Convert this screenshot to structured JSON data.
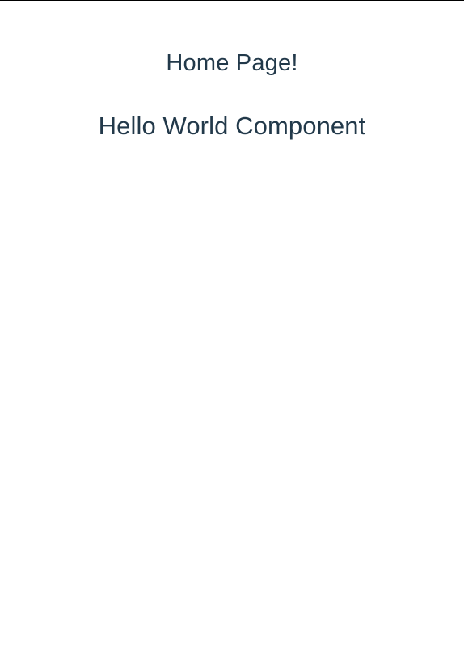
{
  "colors": {
    "text": "#22394a",
    "background": "#ffffff",
    "top_border": "#000000"
  },
  "home": {
    "title": "Home Page!"
  },
  "hello_world": {
    "title": "Hello World Component"
  }
}
